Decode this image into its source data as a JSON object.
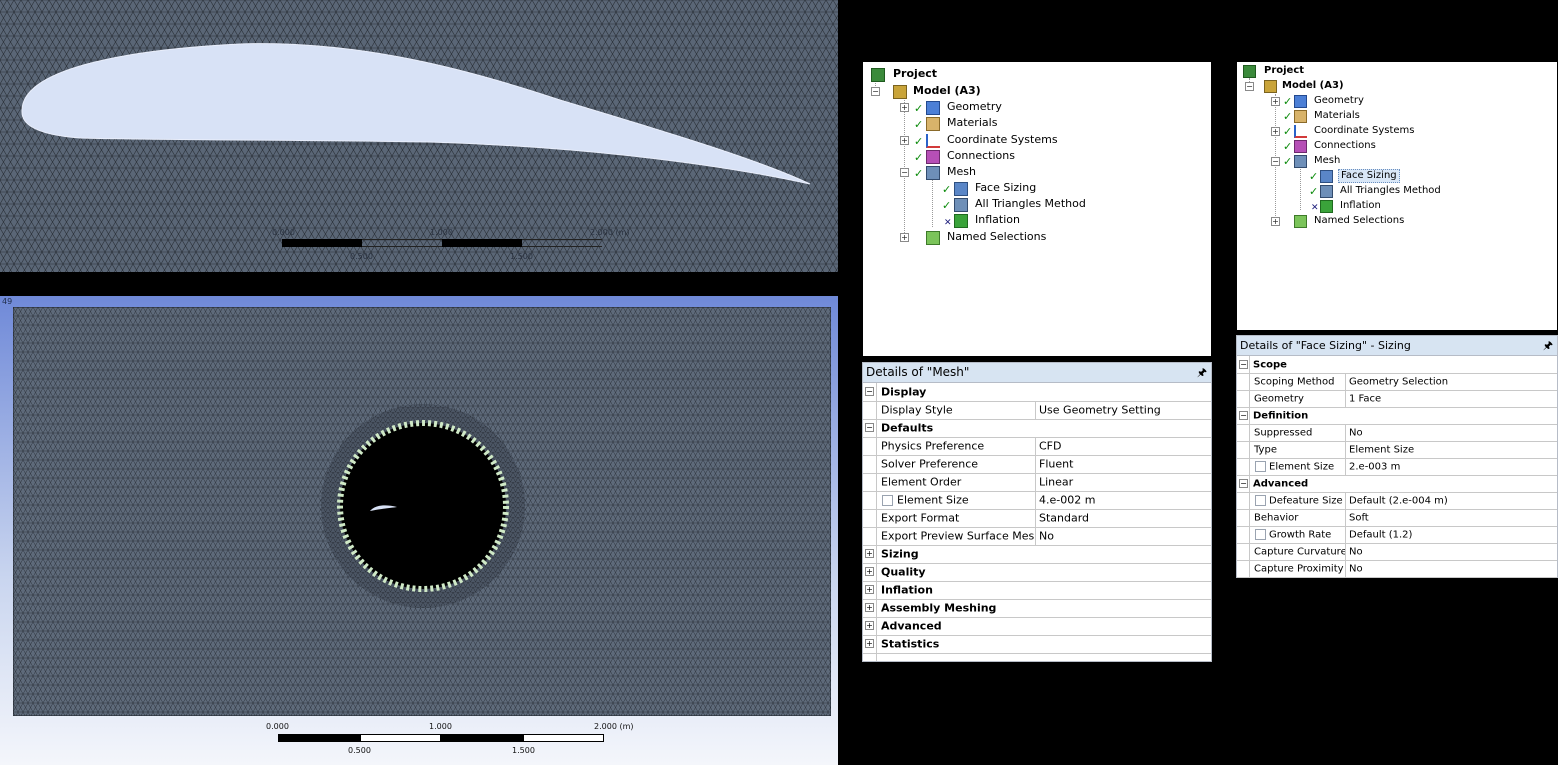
{
  "top_view": {
    "scale_bar": {
      "top_labels": [
        "0.000",
        "1.000",
        "2.000 (m)"
      ],
      "bottom_labels": [
        "0.500",
        "1.500"
      ]
    }
  },
  "bottom_view": {
    "frame_label": "49",
    "scale_bar": {
      "top_labels": [
        "0.000",
        "1.000",
        "2.000 (m)"
      ],
      "bottom_labels": [
        "0.500",
        "1.500"
      ]
    }
  },
  "tree_left": {
    "project": "Project",
    "model": "Model (A3)",
    "items": {
      "geometry": "Geometry",
      "materials": "Materials",
      "coordinate_systems": "Coordinate Systems",
      "connections": "Connections",
      "mesh": "Mesh",
      "face_sizing": "Face Sizing",
      "all_triangles": "All Triangles Method",
      "inflation": "Inflation",
      "named_selections": "Named Selections"
    }
  },
  "tree_right": {
    "project": "Project",
    "model": "Model (A3)",
    "items": {
      "geometry": "Geometry",
      "materials": "Materials",
      "coordinate_systems": "Coordinate Systems",
      "connections": "Connections",
      "mesh": "Mesh",
      "face_sizing": "Face Sizing",
      "all_triangles": "All Triangles Method",
      "inflation": "Inflation",
      "named_selections": "Named Selections"
    }
  },
  "details_mesh": {
    "title": "Details of \"Mesh\"",
    "sections": {
      "display": "Display",
      "defaults": "Defaults",
      "sizing": "Sizing",
      "quality": "Quality",
      "inflation": "Inflation",
      "assembly_meshing": "Assembly Meshing",
      "advanced": "Advanced",
      "statistics": "Statistics"
    },
    "rows": {
      "display_style": {
        "label": "Display Style",
        "value": "Use Geometry Setting"
      },
      "physics_preference": {
        "label": "Physics Preference",
        "value": "CFD"
      },
      "solver_preference": {
        "label": "Solver Preference",
        "value": "Fluent"
      },
      "element_order": {
        "label": "Element Order",
        "value": "Linear"
      },
      "element_size": {
        "label": "Element Size",
        "value": "4.e-002 m"
      },
      "export_format": {
        "label": "Export Format",
        "value": "Standard"
      },
      "export_preview": {
        "label": "Export Preview Surface Mesh",
        "value": "No"
      }
    }
  },
  "details_face": {
    "title": "Details of \"Face Sizing\" - Sizing",
    "sections": {
      "scope": "Scope",
      "definition": "Definition",
      "advanced": "Advanced"
    },
    "rows": {
      "scoping_method": {
        "label": "Scoping Method",
        "value": "Geometry Selection"
      },
      "geometry": {
        "label": "Geometry",
        "value": "1 Face"
      },
      "suppressed": {
        "label": "Suppressed",
        "value": "No"
      },
      "type": {
        "label": "Type",
        "value": "Element Size"
      },
      "element_size": {
        "label": "Element Size",
        "value": "2.e-003 m"
      },
      "defeature_size": {
        "label": "Defeature Size",
        "value": "Default (2.e-004 m)"
      },
      "behavior": {
        "label": "Behavior",
        "value": "Soft"
      },
      "growth_rate": {
        "label": "Growth Rate",
        "value": "Default (1.2)"
      },
      "capture_curvature": {
        "label": "Capture Curvature",
        "value": "No"
      },
      "capture_proximity": {
        "label": "Capture Proximity",
        "value": "No"
      }
    }
  },
  "colors": {
    "mesh_fill": "#5a6676",
    "mesh_lines": "#2a3038",
    "airfoil_fill": "#d8e2f6",
    "header_blue": "#d7e4f2",
    "check_green": "#0a8a0a"
  }
}
